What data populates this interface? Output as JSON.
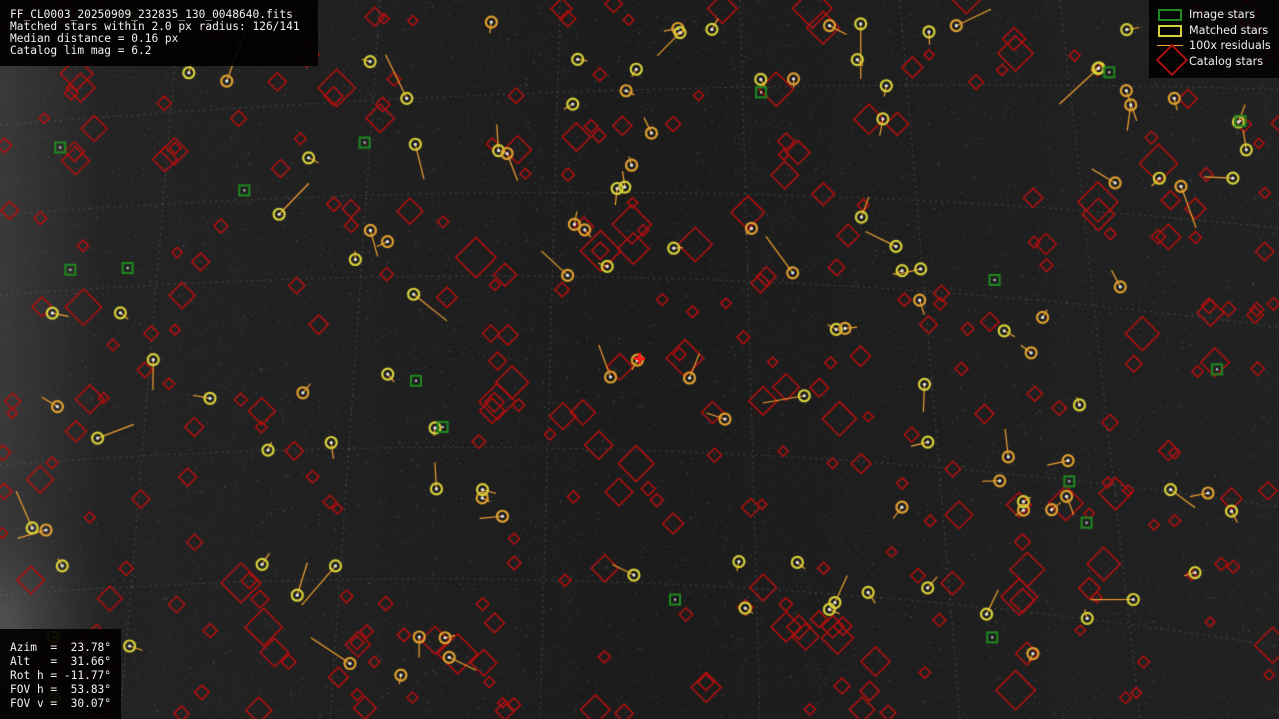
{
  "file": {
    "name": "FF_CL0003_20250909_232835_130_0048640.fits",
    "matched_line": "Matched stars within 2.0 px radius: 126/141",
    "median_line": "Median distance = 0.16 px",
    "catalog_line": "Catalog lim mag = 6.2"
  },
  "legend": {
    "image_stars": "Image stars",
    "matched_stars": "Matched stars",
    "residuals": "100x residuals",
    "catalog_stars": "Catalog stars"
  },
  "pointing": {
    "azim": "Azim  =  23.78°",
    "alt": "Alt   =  31.66°",
    "rot": "Rot h = -11.77°",
    "fov_h": "FOV h =  53.83°",
    "fov_v": "FOV v =  30.07°"
  },
  "colors": {
    "image_star": "#1f8a1f",
    "matched_star": "#d8d23a",
    "residual": "#f0a030",
    "catalog_star": "#b01010",
    "center_marker": "#ff1a1a"
  }
}
